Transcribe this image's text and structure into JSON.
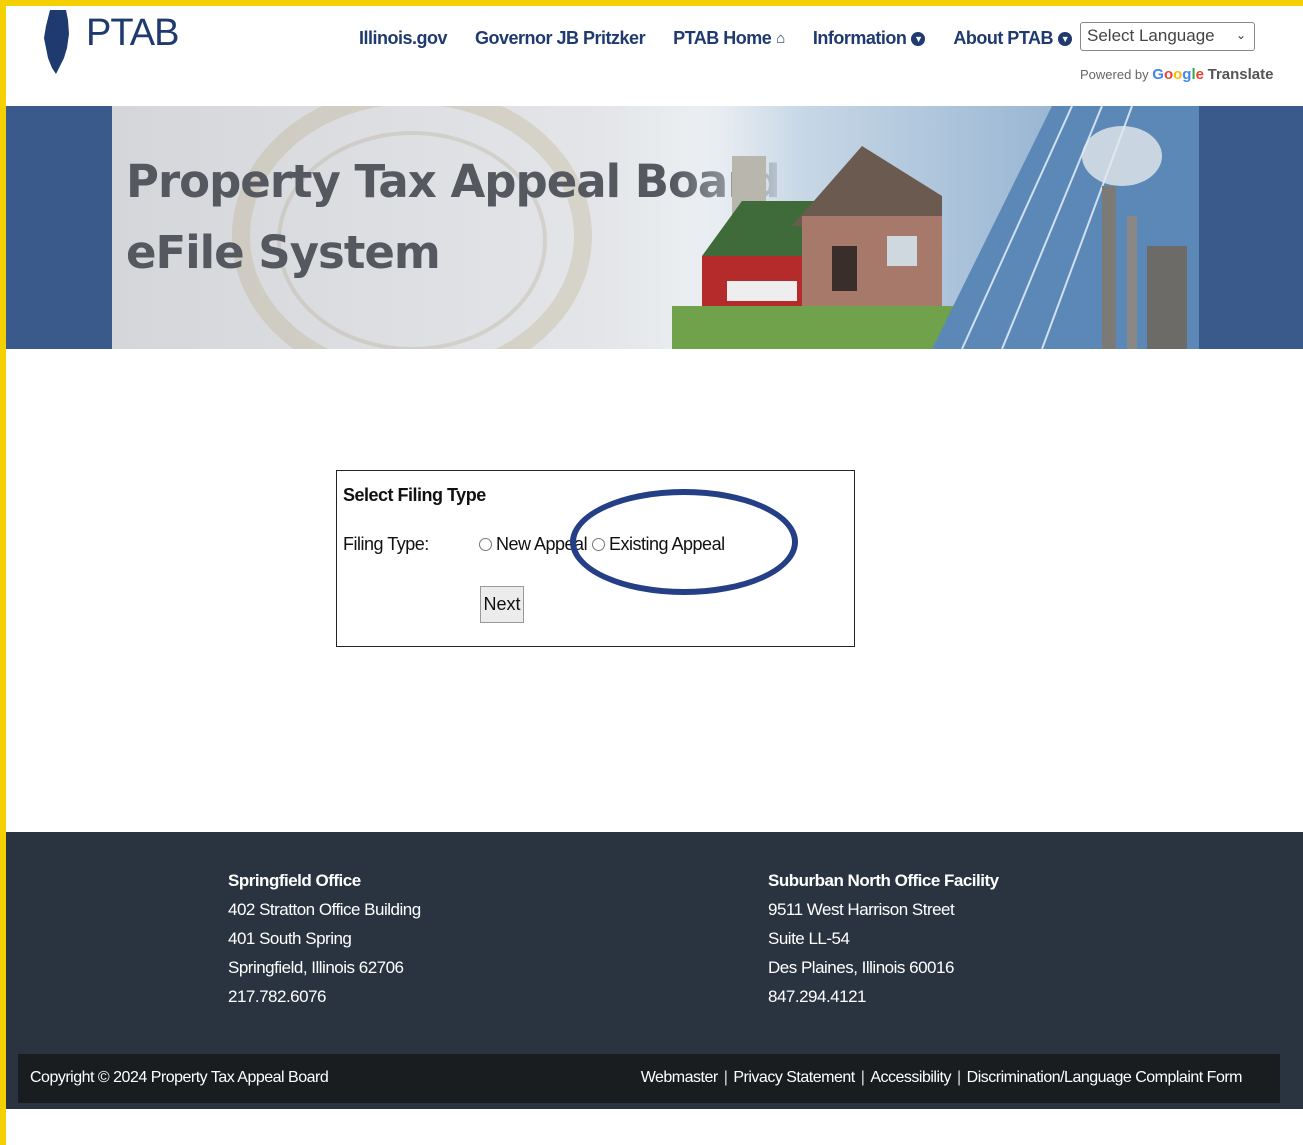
{
  "header": {
    "logo_text": "PTAB",
    "nav": [
      {
        "label": "Illinois.gov",
        "has_dropdown": false,
        "icon": ""
      },
      {
        "label": "Governor JB Pritzker",
        "has_dropdown": false,
        "icon": ""
      },
      {
        "label": "PTAB Home",
        "has_dropdown": false,
        "icon": "home-icon"
      },
      {
        "label": "Information",
        "has_dropdown": true,
        "icon": "chevron-down-circle-icon"
      },
      {
        "label": "About PTAB",
        "has_dropdown": true,
        "icon": "chevron-down-circle-icon"
      }
    ],
    "language_select": {
      "value": "Select Language"
    },
    "powered_by": "Powered by",
    "google": "Google",
    "translate": "Translate"
  },
  "banner": {
    "title_line1": "Property Tax Appeal Board",
    "title_line2": "eFile System"
  },
  "form": {
    "title": "Select Filing Type",
    "filing_label": "Filing Type:",
    "options": [
      {
        "label": "New Appeal",
        "selected": false
      },
      {
        "label": "Existing Appeal",
        "selected": false
      }
    ],
    "next_label": "Next",
    "annotation_color": "#243f86"
  },
  "footer": {
    "offices": [
      {
        "name": "Springfield Office",
        "lines": [
          "402 Stratton Office Building",
          "401 South Spring",
          "Springfield, Illinois 62706",
          "217.782.6076"
        ]
      },
      {
        "name": "Suburban North Office Facility",
        "lines": [
          "9511 West Harrison Street",
          "Suite LL-54",
          "Des Plaines, Illinois 60016",
          "847.294.4121"
        ]
      }
    ],
    "copyright": "Copyright © 2024 Property Tax Appeal Board",
    "links": [
      "Webmaster",
      "Privacy Statement",
      "Accessibility",
      "Discrimination/Language Complaint Form"
    ]
  },
  "colors": {
    "brand_navy": "#1f3a6e",
    "frame_yellow": "#f5d000",
    "footer_bg": "#2a3440",
    "banner_side": "#3a5a8c"
  }
}
